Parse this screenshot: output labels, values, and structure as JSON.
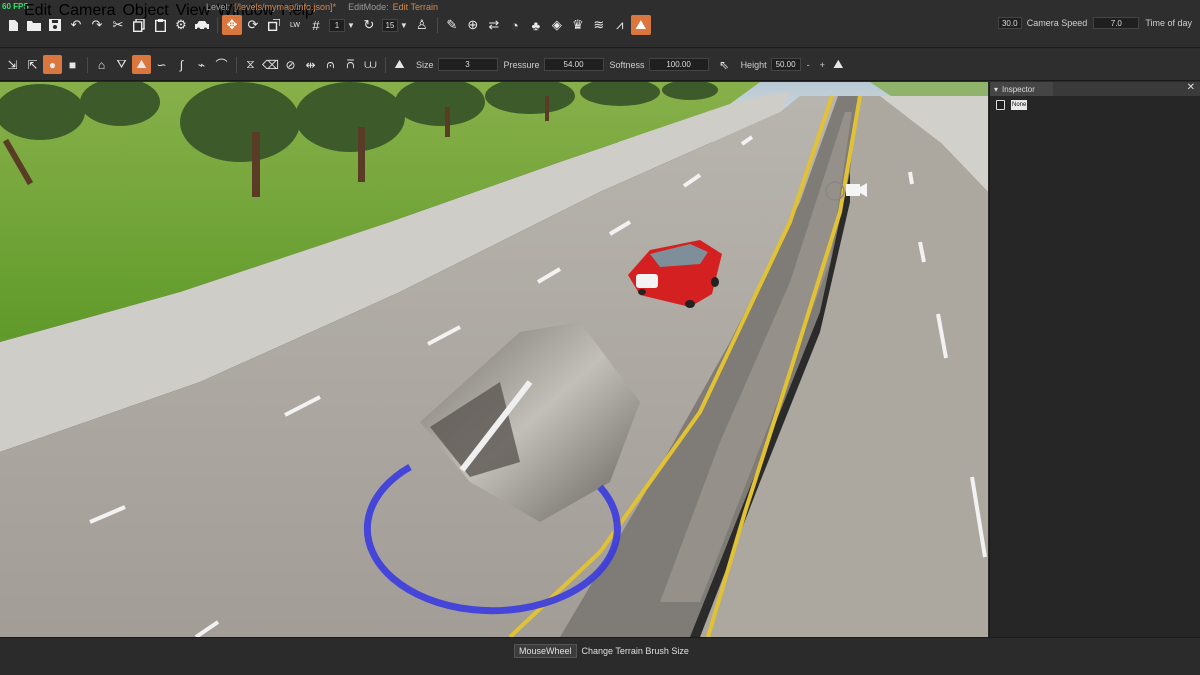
{
  "fps": "60 FPS",
  "menu": [
    "Edit",
    "Camera",
    "Object",
    "View",
    "Window",
    "Help"
  ],
  "level_label": "Level:",
  "level_path": "[/levels/mymap/info.json]*",
  "editmode_label": "EditMode:",
  "editmode_value": "Edit Terrain",
  "toolbar1": {
    "grid_value": "1",
    "rotate_value": "15"
  },
  "camera": {
    "camera_speed_value": "30.0",
    "camera_speed_label": "Camera Speed",
    "time_of_day_value": "7.0",
    "time_of_day_label": "Time of day"
  },
  "brush": {
    "size_label": "Size",
    "size_value": "3",
    "pressure_label": "Pressure",
    "pressure_value": "54.00",
    "softness_label": "Softness",
    "softness_value": "100.00",
    "height_label": "Height",
    "height_value": "50.00",
    "minus": "-",
    "plus": "+"
  },
  "inspector": {
    "title": "Inspector",
    "none_badge": "None"
  },
  "status": {
    "key": "MouseWheel",
    "text": "Change Terrain Brush Size"
  },
  "colors": {
    "accent": "#d9773e",
    "brush_ring": "#3b3be0",
    "car": "#d42020",
    "grass": "#6fa33a"
  }
}
